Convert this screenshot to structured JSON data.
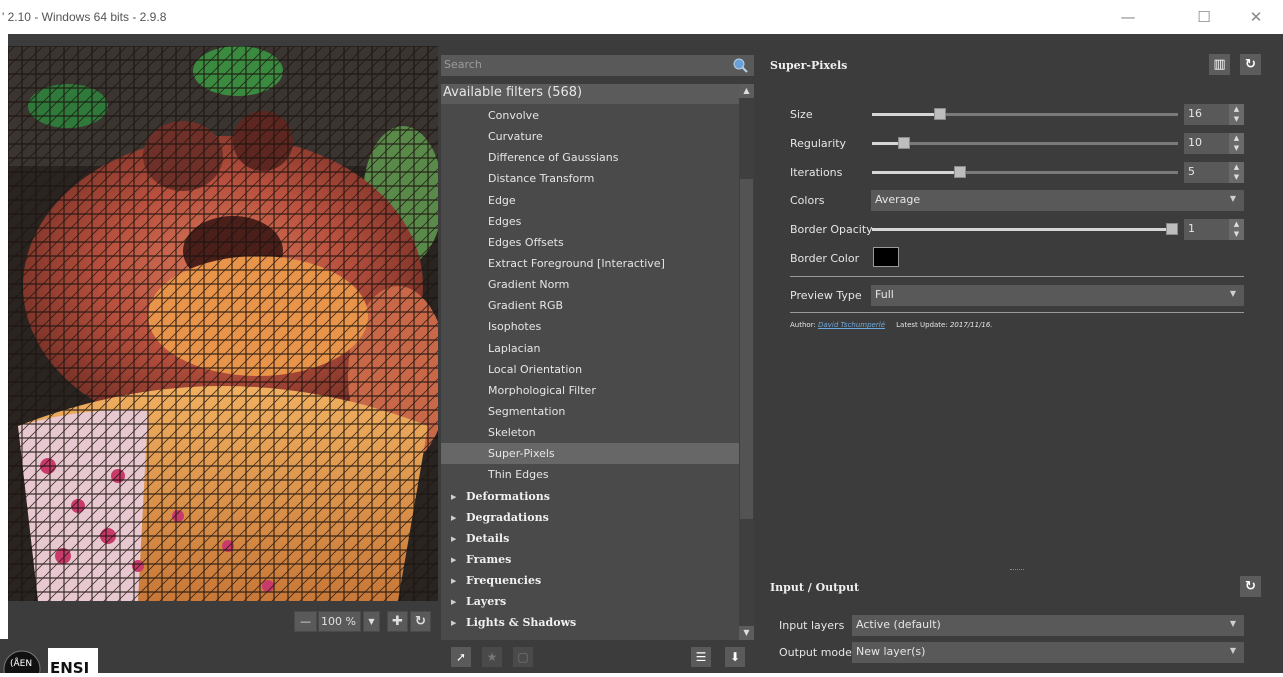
{
  "window": {
    "title": "' 2.10 - Windows 64 bits - 2.9.8",
    "minimize": "—",
    "maximize": "☐",
    "close": "✕"
  },
  "preview": {
    "zoom_value": "100 %",
    "zoom_out_icon": "minus-icon",
    "zoom_in_icon": "zoom-in-icon",
    "reset_icon": "refresh-icon",
    "logo_left": "(ÅEN",
    "logo_right": "ENSI"
  },
  "filters": {
    "search_placeholder": "Search",
    "header": "Available filters (568)",
    "items": [
      "Convolve",
      "Curvature",
      "Difference of Gaussians",
      "Distance Transform",
      "Edge",
      "Edges",
      "Edges Offsets",
      "Extract Foreground [Interactive]",
      "Gradient Norm",
      "Gradient RGB",
      "Isophotes",
      "Laplacian",
      "Local Orientation",
      "Morphological Filter",
      "Segmentation",
      "Skeleton",
      "Super-Pixels",
      "Thin Edges"
    ],
    "selected": "Super-Pixels",
    "categories": [
      "Deformations",
      "Degradations",
      "Details",
      "Frames",
      "Frequencies",
      "Layers",
      "Lights & Shadows"
    ]
  },
  "params": {
    "title": "Super-Pixels",
    "size": {
      "label": "Size",
      "value": "16",
      "fraction": 0.21
    },
    "regularity": {
      "label": "Regularity",
      "value": "10",
      "fraction": 0.09
    },
    "iterations": {
      "label": "Iterations",
      "value": "5",
      "fraction": 0.28
    },
    "colors": {
      "label": "Colors",
      "value": "Average"
    },
    "border_opacity": {
      "label": "Border Opacity",
      "value": "1",
      "fraction": 1.0
    },
    "border_color": {
      "label": "Border Color",
      "color": "#000000"
    },
    "preview_type": {
      "label": "Preview Type",
      "value": "Full"
    },
    "author_label": "Author:",
    "author_name": "David Tschumperlé",
    "update_label": "Latest Update:",
    "update_date": "2017/11/16."
  },
  "io": {
    "title": "Input / Output",
    "input_label": "Input layers",
    "input_value": "Active (default)",
    "output_label": "Output mode",
    "output_value": "New layer(s)"
  }
}
